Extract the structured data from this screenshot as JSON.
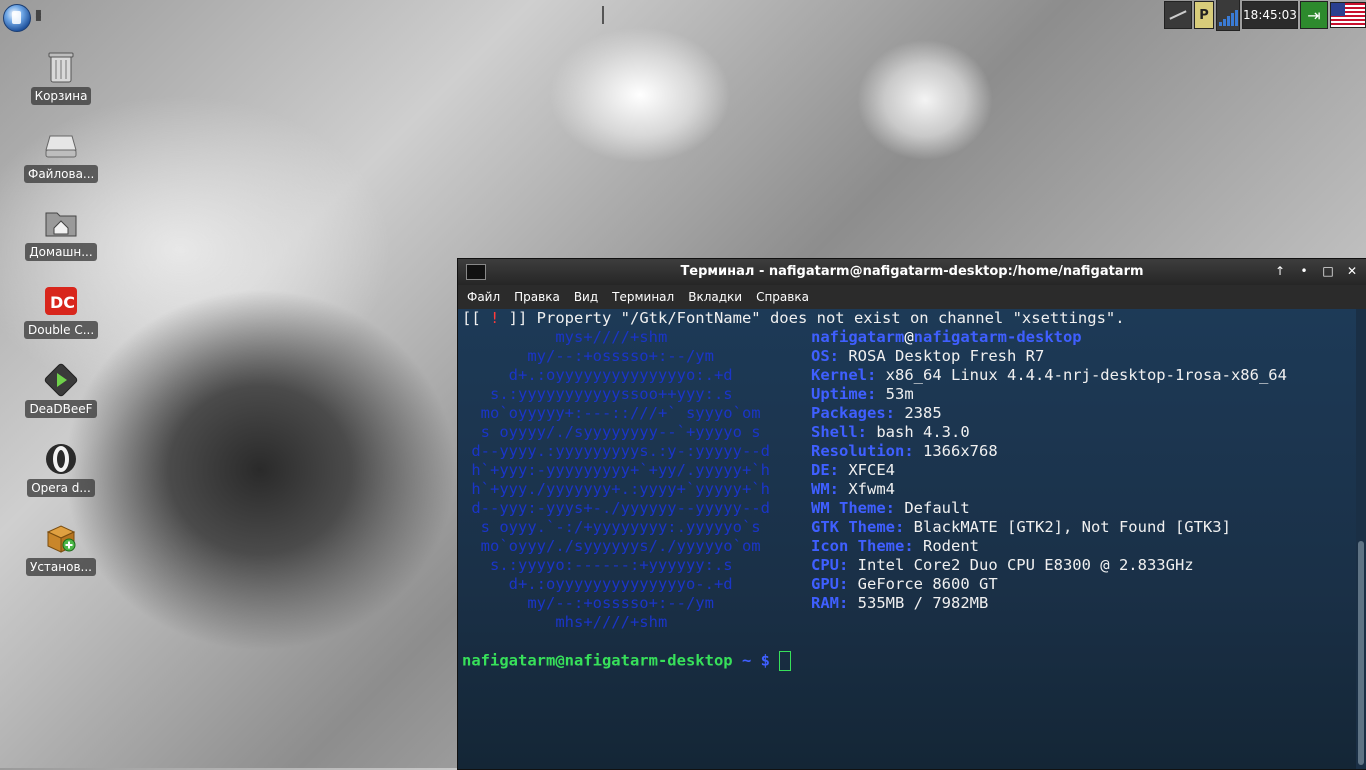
{
  "panel": {
    "clock": "18:45:03",
    "p_label": "P"
  },
  "desktop_icons": [
    {
      "label": "Корзина",
      "icon": "trash-icon"
    },
    {
      "label": "Файлова...",
      "icon": "drive-icon"
    },
    {
      "label": "Домашн...",
      "icon": "home-folder-icon"
    },
    {
      "label": "Double C...",
      "icon": "double-commander-icon"
    },
    {
      "label": "DeaDBeeF",
      "icon": "deadbeef-icon"
    },
    {
      "label": "Opera d...",
      "icon": "opera-icon"
    },
    {
      "label": "Установ...",
      "icon": "install-package-icon"
    }
  ],
  "terminal": {
    "title": "Терминал - nafigatarm@nafigatarm-desktop:/home/nafigatarm",
    "menu": [
      "Файл",
      "Правка",
      "Вид",
      "Терминал",
      "Вкладки",
      "Справка"
    ],
    "warning_prefix": "[[ ",
    "warning_bang": "!",
    "warning_suffix": " ]] Property \"/Gtk/FontName\" does not exist on channel \"xsettings\".",
    "user": "nafigatarm",
    "at": "@",
    "host": "nafigatarm-desktop",
    "art": [
      "          mys+////+shm",
      "       my/--:+osssso+:--/ym",
      "     d+.:oyyyyyyyyyyyyyyo:.+d",
      "   s.:yyyyyyyyyyyssoo++yyy:.s",
      "  mo`oyyyyy+:---::///+` syyyo`om",
      "  s oyyyy/./syyyyyyyy--`+yyyyo s",
      " d--yyyy.:yyyyyyyyys.:y-:yyyyy--d",
      " h`+yyy:-yyyyyyyyy+`+yy/.yyyyy+`h",
      " h`+yyy./yyyyyyy+.:yyyy+`yyyyy+`h",
      " d--yyy:-yyys+-./yyyyyy--yyyyy--d",
      "  s oyyy.`-:/+yyyyyyyy:.yyyyyo`s",
      "  mo`oyyy/./syyyyyys/./yyyyyo`om",
      "   s.:yyyyo:------:+yyyyyy:.s",
      "     d+.:oyyyyyyyyyyyyyyo-.+d",
      "       my/--:+osssso+:--/ym",
      "          mhs+////+shm"
    ],
    "info": [
      {
        "key": "OS:",
        "value": "ROSA Desktop Fresh R7"
      },
      {
        "key": "Kernel:",
        "value": "x86_64 Linux 4.4.4-nrj-desktop-1rosa-x86_64"
      },
      {
        "key": "Uptime:",
        "value": "53m"
      },
      {
        "key": "Packages:",
        "value": "2385"
      },
      {
        "key": "Shell:",
        "value": "bash 4.3.0"
      },
      {
        "key": "Resolution:",
        "value": "1366x768"
      },
      {
        "key": "DE:",
        "value": "XFCE4"
      },
      {
        "key": "WM:",
        "value": "Xfwm4"
      },
      {
        "key": "WM Theme:",
        "value": "Default"
      },
      {
        "key": "GTK Theme:",
        "value": "BlackMATE [GTK2], Not Found [GTK3]"
      },
      {
        "key": "Icon Theme:",
        "value": "Rodent"
      },
      {
        "key": "CPU:",
        "value": "Intel Core2 Duo CPU E8300 @ 2.833GHz"
      },
      {
        "key": "GPU:",
        "value": "GeForce 8600 GT"
      },
      {
        "key": "RAM:",
        "value": "535MB / 7982MB"
      }
    ],
    "prompt_user": "nafigatarm@nafigatarm-desktop",
    "prompt_suffix": " ~ $ "
  }
}
